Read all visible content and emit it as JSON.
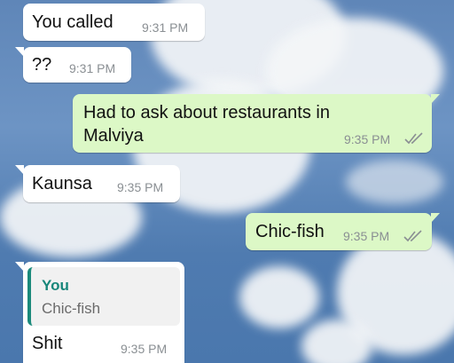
{
  "colors": {
    "incoming_bubble": "#ffffff",
    "outgoing_bubble": "#dcf8c6",
    "quote_accent": "#1b8a7b",
    "timestamp": "#8a8f93",
    "read_ticks": "#8a8f93"
  },
  "messages": [
    {
      "direction": "incoming",
      "text": "You called",
      "time": "9:31 PM"
    },
    {
      "direction": "incoming",
      "text": "??",
      "time": "9:31 PM"
    },
    {
      "direction": "outgoing",
      "text_line1": "Had to ask about restaurants in",
      "text_line2": "Malviya",
      "time": "9:35 PM",
      "status_icon": "double-check-icon"
    },
    {
      "direction": "incoming",
      "text": "Kaunsa",
      "time": "9:35 PM"
    },
    {
      "direction": "outgoing",
      "text": "Chic-fish",
      "time": "9:35 PM",
      "status_icon": "double-check-icon"
    },
    {
      "direction": "incoming",
      "quote": {
        "author": "You",
        "text": "Chic-fish"
      },
      "text": "Shit",
      "time": "9:35 PM"
    }
  ]
}
